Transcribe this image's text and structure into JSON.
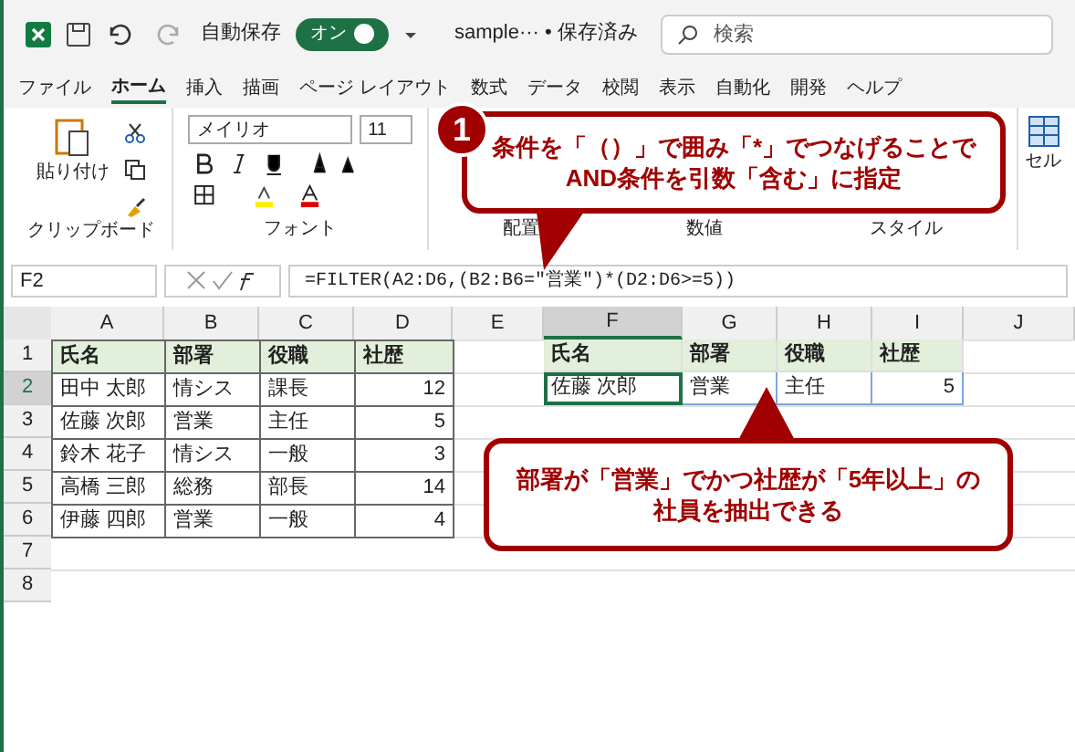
{
  "title_bar": {
    "autosave_label": "自動保存",
    "autosave_toggle": {
      "on": true,
      "label": "オン"
    },
    "file_name": "sample··· • 保存済み",
    "search_placeholder": "検索"
  },
  "menu_tabs": [
    {
      "label": "ファイル",
      "selected": false
    },
    {
      "label": "ホーム",
      "selected": true
    },
    {
      "label": "挿入",
      "selected": false
    },
    {
      "label": "描画",
      "selected": false
    },
    {
      "label": "ページ レイアウト",
      "selected": false
    },
    {
      "label": "数式",
      "selected": false
    },
    {
      "label": "データ",
      "selected": false
    },
    {
      "label": "校閲",
      "selected": false
    },
    {
      "label": "表示",
      "selected": false
    },
    {
      "label": "自動化",
      "selected": false
    },
    {
      "label": "開発",
      "selected": false
    },
    {
      "label": "ヘルプ",
      "selected": false
    }
  ],
  "ribbon": {
    "paste_label": "貼り付け",
    "font_name": "メイリオ",
    "font_size": "11",
    "groups": [
      "クリップボード",
      "フォント",
      "配置",
      "数値",
      "スタイル"
    ],
    "cell_label": "セル"
  },
  "formula_bar": {
    "cell_ref": "F2",
    "formula": "=FILTER(A2:D6,(B2:B6=\"営業\")*(D2:D6>=5))"
  },
  "sheet": {
    "columns": [
      {
        "label": "A",
        "selected": false
      },
      {
        "label": "B",
        "selected": false
      },
      {
        "label": "C",
        "selected": false
      },
      {
        "label": "D",
        "selected": false
      },
      {
        "label": "E",
        "selected": false
      },
      {
        "label": "F",
        "selected": true
      },
      {
        "label": "G",
        "selected": false
      },
      {
        "label": "H",
        "selected": false
      },
      {
        "label": "I",
        "selected": false
      },
      {
        "label": "J",
        "selected": false
      }
    ],
    "row_headers": [
      {
        "label": "1",
        "selected": false
      },
      {
        "label": "2",
        "selected": true
      },
      {
        "label": "3",
        "selected": false
      },
      {
        "label": "4",
        "selected": false
      },
      {
        "label": "5",
        "selected": false
      },
      {
        "label": "6",
        "selected": false
      },
      {
        "label": "7",
        "selected": false
      },
      {
        "label": "8",
        "selected": false
      }
    ],
    "source_table": {
      "header": [
        "氏名",
        "部署",
        "役職",
        "社歴"
      ],
      "rows": [
        [
          "田中 太郎",
          "情シス",
          "課長",
          "12"
        ],
        [
          "佐藤 次郎",
          "営業",
          "主任",
          "5"
        ],
        [
          "鈴木 花子",
          "情シス",
          "一般",
          "3"
        ],
        [
          "高橋 三郎",
          "総務",
          "部長",
          "14"
        ],
        [
          "伊藤 四郎",
          "営業",
          "一般",
          "4"
        ]
      ]
    },
    "result_table": {
      "header": [
        "氏名",
        "部署",
        "役職",
        "社歴"
      ],
      "rows": [
        [
          "佐藤 次郎",
          "営業",
          "主任",
          "5"
        ]
      ]
    }
  },
  "callouts": [
    {
      "number": "1",
      "lines": [
        "条件を「（）」で囲み「*」でつなげることで",
        "AND条件を引数「含む」に指定"
      ]
    },
    {
      "lines": [
        "部署が「営業」でかつ社歴が「5年以上」の",
        "社員を抽出できる"
      ]
    }
  ]
}
